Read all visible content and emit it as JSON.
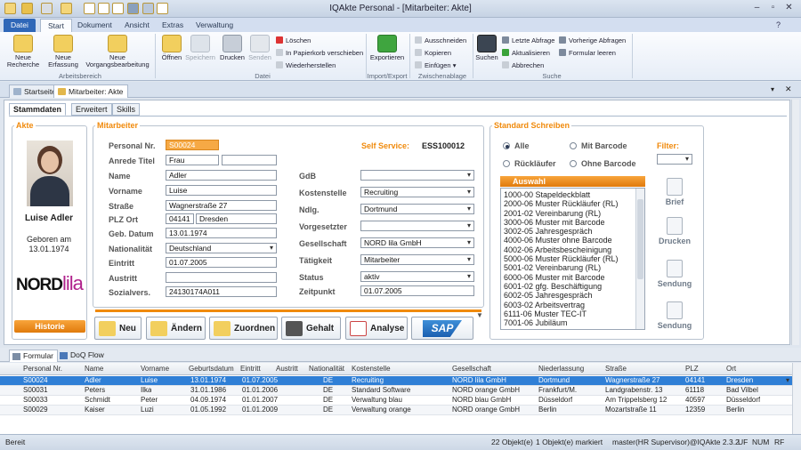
{
  "window": {
    "title": "IQAkte Personal - [Mitarbeiter: Akte]"
  },
  "ribbon_tabs": [
    "Datei",
    "Start",
    "Dokument",
    "Ansicht",
    "Extras",
    "Verwaltung"
  ],
  "ribbon": {
    "arbeitsbereich": {
      "label": "Arbeitsbereich",
      "neue_recherche": "Neue Recherche",
      "neue_erfassung": "Neue Erfassung",
      "neue_vorgangsbearbeitung": "Neue Vorgangsbearbeitung"
    },
    "datei": {
      "label": "Datei",
      "oeffnen": "Öffnen",
      "speichern": "Speichern",
      "drucken": "Drucken",
      "senden": "Senden",
      "loeschen": "Löschen",
      "in_papierkorb": "In Papierkorb verschieben",
      "wiederherstellen": "Wiederherstellen"
    },
    "import_export": {
      "label": "Import/Export",
      "exportieren": "Exportieren"
    },
    "zwischenablage": {
      "label": "Zwischenablage",
      "ausschneiden": "Ausschneiden",
      "kopieren": "Kopieren",
      "einfuegen": "Einfügen"
    },
    "suche": {
      "label": "Suche",
      "suchen": "Suchen",
      "letzte_abfrage": "Letzte Abfrage",
      "aktualisieren": "Aktualisieren",
      "abbrechen": "Abbrechen",
      "vorherige_abfragen": "Vorherige Abfragen",
      "formular_leeren": "Formular leeren"
    }
  },
  "doc_tabs": [
    "Startseite",
    "Mitarbeiter: Akte"
  ],
  "inner_tabs": [
    "Stammdaten",
    "Erweitert",
    "Skills"
  ],
  "akte": {
    "legend": "Akte",
    "name": "Luise Adler",
    "geboren_label": "Geboren am",
    "geboren_date": "13.01.1974",
    "logo_nord": "NORD",
    "logo_lila": "lila",
    "historie": "Historie"
  },
  "mitarbeiter": {
    "legend": "Mitarbeiter",
    "personal_nr_label": "Personal Nr.",
    "personal_nr": "S00024",
    "self_service_label": "Self Service:",
    "self_service": "ESS100012",
    "anrede_label": "Anrede Titel",
    "anrede": "Frau",
    "titel": "",
    "name_label": "Name",
    "name": "Adler",
    "vorname_label": "Vorname",
    "vorname": "Luise",
    "strasse_label": "Straße",
    "strasse": "Wagnerstraße 27",
    "plz_label": "PLZ Ort",
    "plz": "04141",
    "ort": "Dresden",
    "geb_label": "Geb. Datum",
    "geb": "13.01.1974",
    "nat_label": "Nationalität",
    "nat": "Deutschland",
    "eintritt_label": "Eintritt",
    "eintritt": "01.07.2005",
    "austritt_label": "Austritt",
    "austritt": "",
    "sozial_label": "Sozialvers.",
    "sozial": "24130174A011",
    "gdb_label": "GdB",
    "gdb": "",
    "kostenstelle_label": "Kostenstelle",
    "kostenstelle": "Recruiting",
    "ndlg_label": "Ndlg.",
    "ndlg": "Dortmund",
    "vorgesetzter_label": "Vorgesetzter",
    "vorgesetzter": "",
    "gesellschaft_label": "Gesellschaft",
    "gesellschaft": "NORD lila GmbH",
    "taetigkeit_label": "Tätigkeit",
    "taetigkeit": "Mitarbeiter",
    "status_label": "Status",
    "status": "aktiv",
    "zeitpunkt_label": "Zeitpunkt",
    "zeitpunkt": "01.07.2005"
  },
  "actions": {
    "neu": "Neu",
    "aendern": "Ändern",
    "zuordnen": "Zuordnen",
    "gehalt": "Gehalt",
    "analyse": "Analyse",
    "sap": "SAP"
  },
  "schreiben": {
    "legend": "Standard Schreiben",
    "alle": "Alle",
    "mit_barcode": "Mit Barcode",
    "ruecklaeufer": "Rückläufer",
    "ohne_barcode": "Ohne Barcode",
    "filter_label": "Filter:",
    "auswahl": "Auswahl",
    "items": [
      "1000-00 Stapeldeckblatt",
      "2000-06 Muster Rückläufer (RL)",
      "2001-02 Vereinbarung (RL)",
      "3000-06 Muster mit Barcode",
      "3002-05 Jahresgespräch",
      "4000-06 Muster ohne Barcode",
      "4002-06 Arbeitsbescheinigung",
      "5000-06 Muster Rückläufer (RL)",
      "5001-02 Vereinbarung (RL)",
      "6000-06 Muster mit Barcode",
      "6001-02 gfg. Beschäftigung",
      "6002-05 Jahresgespräch",
      "6003-02 Arbeitsvertrag",
      "6111-06 Muster TEC-IT",
      "7001-06 Jubiläum"
    ],
    "brief": "Brief",
    "drucken": "Drucken",
    "sendung1": "Sendung",
    "sendung2": "Sendung"
  },
  "grid_tabs": [
    "Formular",
    "DoQ Flow"
  ],
  "grid": {
    "columns": [
      "Personal Nr.",
      "Name",
      "Vorname",
      "Geburtsdatum",
      "Eintritt",
      "Austritt",
      "Nationalität",
      "Kostenstelle",
      "Gesellschaft",
      "Niederlassung",
      "Straße",
      "PLZ",
      "Ort"
    ],
    "rows": [
      [
        "S00024",
        "Adler",
        "Luise",
        "13.01.1974",
        "01.07.2005",
        "",
        "DE",
        "Recruiting",
        "NORD lila GmbH",
        "Dortmund",
        "Wagnerstraße 27",
        "04141",
        "Dresden"
      ],
      [
        "S00031",
        "Peters",
        "Ilka",
        "31.01.1986",
        "01.01.2006",
        "",
        "DE",
        "Standard Software",
        "NORD orange GmbH",
        "Frankfurt/M.",
        "Landgrabenstr. 13",
        "61118",
        "Bad Vilbel"
      ],
      [
        "S00033",
        "Schmidt",
        "Peter",
        "04.09.1974",
        "01.01.2007",
        "",
        "DE",
        "Verwaltung blau",
        "NORD blau GmbH",
        "Düsseldorf",
        "Am Trippelsberg 12",
        "40597",
        "Düsseldorf"
      ],
      [
        "S00029",
        "Kaiser",
        "Luzi",
        "01.05.1992",
        "01.01.2009",
        "",
        "DE",
        "Verwaltung orange",
        "NORD orange GmbH",
        "Berlin",
        "Mozartstraße 11",
        "12359",
        "Berlin"
      ]
    ]
  },
  "status": {
    "left": "Bereit",
    "objekte": "22 Objekt(e)",
    "markiert": "1 Objekt(e) markiert",
    "user": "master(HR Supervisor)@IQAkte 2.3.2",
    "uf": "UF",
    "num": "NUM",
    "rf": "RF"
  },
  "colors": {
    "accent_orange": "#f08a0c",
    "selected_blue": "#2f7fd6",
    "lila": "#b0228c",
    "datei_tab": "#2f67b8"
  }
}
